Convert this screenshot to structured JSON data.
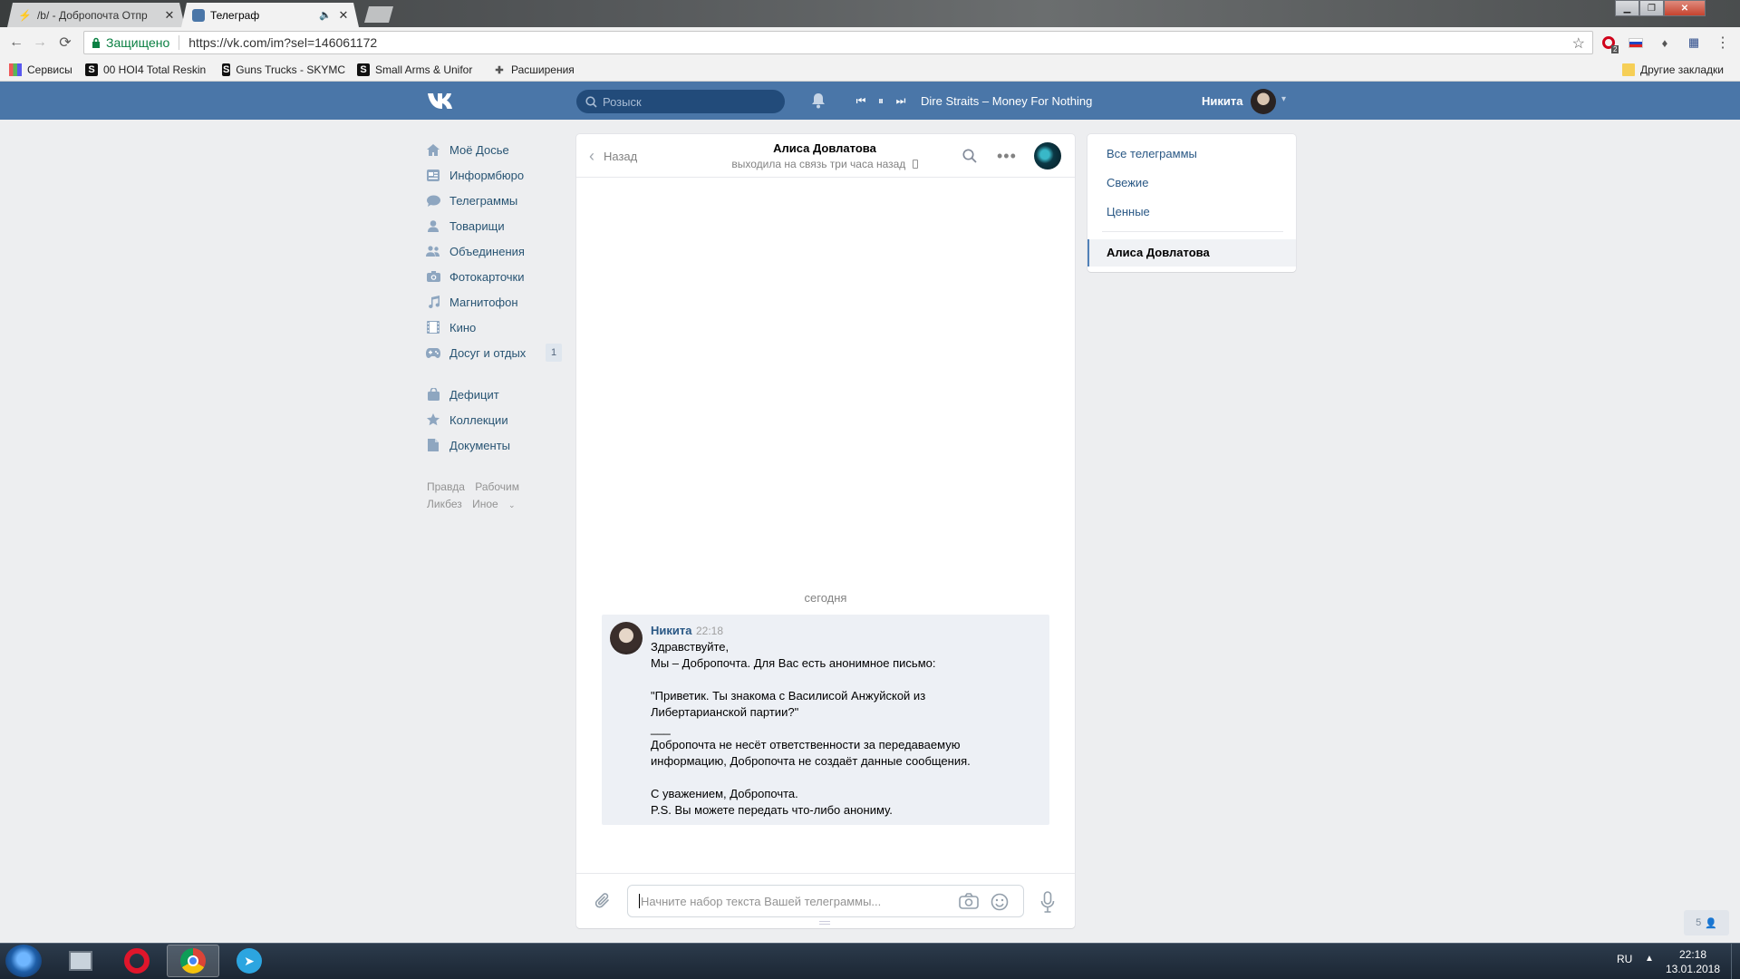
{
  "browser": {
    "tabs": [
      {
        "title": "/b/ - Добропочта Отпр",
        "active": false
      },
      {
        "title": "Телеграф",
        "active": true
      }
    ],
    "secure_label": "Защищено",
    "url": "https://vk.com/im?sel=146061172",
    "bookmarks": [
      {
        "label": "Сервисы"
      },
      {
        "label": "00 HOI4 Total Reskin"
      },
      {
        "label": "Guns Trucks - SKYMC"
      },
      {
        "label": "Small Arms & Unifor"
      },
      {
        "label": "Расширения"
      }
    ],
    "other_bookmarks": "Другие закладки",
    "opera_badge": "2"
  },
  "header": {
    "search_placeholder": "Розыск",
    "track": "Dire Straits – Money For Nothing",
    "user_name": "Никита"
  },
  "sidebar": {
    "items": [
      {
        "label": "Моё Досье",
        "icon": "home-icon"
      },
      {
        "label": "Информбюро",
        "icon": "news-icon"
      },
      {
        "label": "Телеграммы",
        "icon": "messages-icon"
      },
      {
        "label": "Товарищи",
        "icon": "friends-icon"
      },
      {
        "label": "Объединения",
        "icon": "groups-icon"
      },
      {
        "label": "Фотокарточки",
        "icon": "camera-icon"
      },
      {
        "label": "Магнитофон",
        "icon": "music-icon"
      },
      {
        "label": "Кино",
        "icon": "video-icon"
      },
      {
        "label": "Досуг и отдых",
        "icon": "gamepad-icon",
        "badge": "1"
      }
    ],
    "items2": [
      {
        "label": "Дефицит",
        "icon": "bag-icon"
      },
      {
        "label": "Коллекции",
        "icon": "star-icon"
      },
      {
        "label": "Документы",
        "icon": "document-icon"
      }
    ],
    "footer": {
      "l1": "Правда",
      "l2": "Рабочим",
      "l3": "Ликбез",
      "l4": "Иное"
    }
  },
  "chat": {
    "back_label": "Назад",
    "peer_name": "Алиса Довлатова",
    "peer_status": "выходила на связь три часа назад",
    "day_label": "сегодня",
    "message": {
      "author": "Никита",
      "time": "22:18",
      "lines": [
        "Здравствуйте,",
        "Мы – Добропочта. Для Вас есть анонимное письмо:",
        "",
        "\"Приветик. Ты знакома с Василисой Анжуйской из",
        "Либертарианской партии?\"",
        "___",
        "Добропочта не несёт ответственности за передаваемую",
        "информацию, Добропочта не создаёт данные сообщения.",
        "",
        "С уважением, Добропочта.",
        "P.S. Вы можете передать что-либо анониму."
      ]
    },
    "composer_placeholder": "Начните набор текста Вашей телеграммы..."
  },
  "filters": {
    "all": "Все телеграммы",
    "fresh": "Свежие",
    "valuable": "Ценные",
    "selected_dialog": "Алиса Довлатова"
  },
  "online_count": "5",
  "taskbar": {
    "lang": "RU",
    "time": "22:18",
    "date": "13.01.2018"
  },
  "colors": {
    "vk_blue": "#4a76a8",
    "link": "#2a5885",
    "page_bg": "#edeef0",
    "message_bg": "#edf0f5"
  }
}
